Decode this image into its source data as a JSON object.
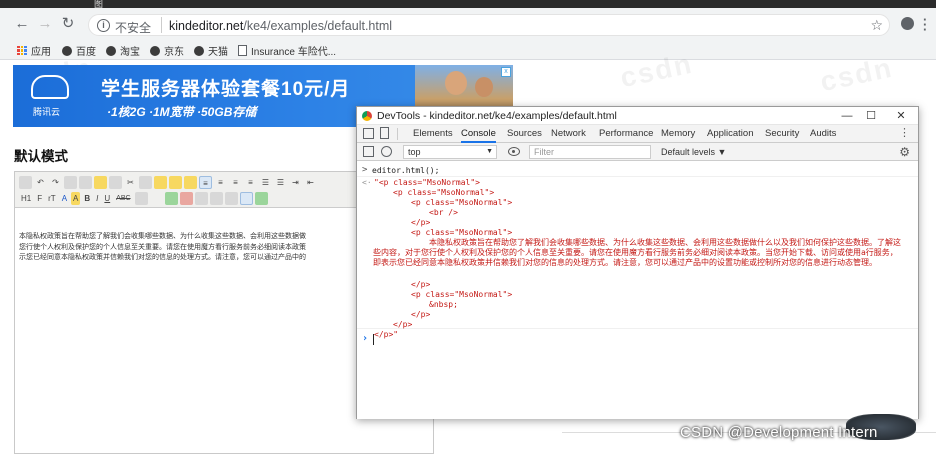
{
  "browser": {
    "title_fragment": "图",
    "insecure_label": "不安全",
    "url_host": "kindeditor.net",
    "url_path": "/ke4/examples/default.html",
    "bookmarks": [
      "应用",
      "百度",
      "淘宝",
      "京东",
      "天猫",
      "Insurance 车险代..."
    ]
  },
  "banner": {
    "brand": "腾讯云",
    "title": "学生服务器体验套餐10元/月",
    "subtitle": "·1核2G ·1M宽带 ·50GB存储",
    "ad_mark": "x"
  },
  "page": {
    "heading": "默认模式"
  },
  "editor": {
    "toolbar_row2_labels": [
      "H1",
      "F",
      "rT",
      "A",
      "A",
      "B",
      "I",
      "U",
      "ABC"
    ],
    "body_lines": [
      "本隐私权政策旨在帮助您了解我们会收集哪些数据、为什么收集这些数据、会利用这些数据做",
      "您行使个人权利及保护您的个人信息至关重要。请您在使用魔方看行服务前务必细阅读本政策",
      "示您已经同意本隐私权政策并信赖我们对您的信息的处理方式。请注意，您可以通过产品中的"
    ]
  },
  "devtools": {
    "title": "DevTools - kindeditor.net/ke4/examples/default.html",
    "tabs": [
      "Elements",
      "Console",
      "Sources",
      "Network",
      "Performance",
      "Memory",
      "Application",
      "Security",
      "Audits"
    ],
    "active_tab": "Console",
    "context": "top",
    "filter_placeholder": "Filter",
    "levels": "Default levels ▼",
    "command": "editor.html();",
    "output": {
      "l1": "\"<p class=\"MsoNormal\">",
      "l2": "<p class=\"MsoNormal\">",
      "l3": "<p class=\"MsoNormal\">",
      "l4": "<br />",
      "l5": "</p>",
      "l6": "<p class=\"MsoNormal\">",
      "l7": "本隐私权政策旨在帮助您了解我们会收集哪些数据、为什么收集这些数据、会利用这些数据做什么以及我们如何保护这些数据。了解这些内容，对于您行使个人权利及保护您的个人信息至关重要。请您在使用魔方看行服务前务必细对阅读本政策。当您开始下载、访问或使用a行服务，即表示您已经同意本隐私权政策并信赖我们对您的信息的处理方式。请注意，您可以通过产品中的设置功能或控制所对您的信息进行动态管理。",
      "l8": "</p>",
      "l9": "<p class=\"MsoNormal\">",
      "l10": "&nbsp;",
      "l11": "</p>",
      "l12": "</p>",
      "l13": "</p>\""
    }
  },
  "watermark": {
    "csdn": "CSDN @Development Intern",
    "bg_text": "csdn"
  }
}
